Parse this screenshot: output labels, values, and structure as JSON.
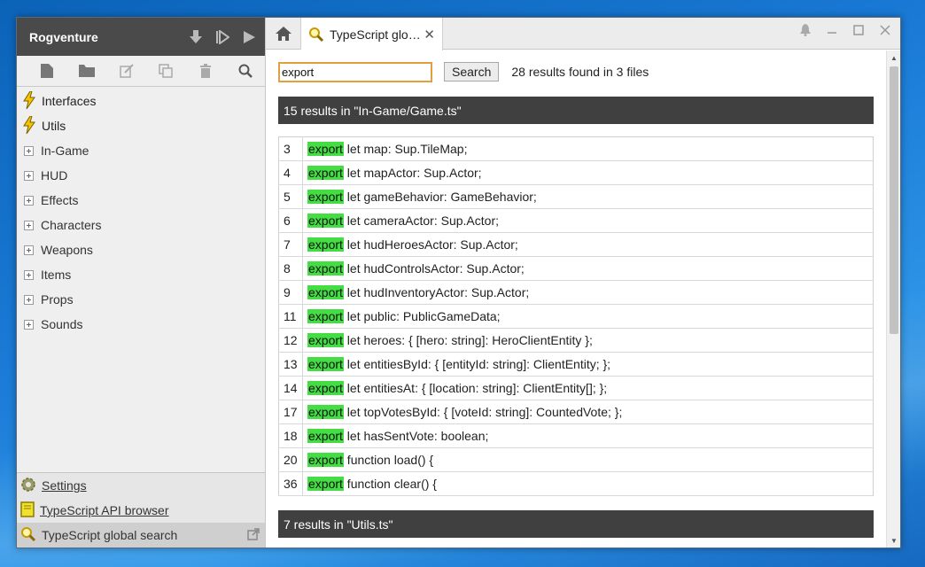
{
  "app": {
    "project_name": "Rogventure"
  },
  "sidebar": {
    "tree": [
      {
        "label": "Interfaces",
        "kind": "script",
        "icon": "lightning-icon"
      },
      {
        "label": "Utils",
        "kind": "script",
        "icon": "lightning-icon"
      },
      {
        "label": "In-Game",
        "kind": "folder"
      },
      {
        "label": "HUD",
        "kind": "folder"
      },
      {
        "label": "Effects",
        "kind": "folder"
      },
      {
        "label": "Characters",
        "kind": "folder"
      },
      {
        "label": "Weapons",
        "kind": "folder"
      },
      {
        "label": "Items",
        "kind": "folder"
      },
      {
        "label": "Props",
        "kind": "folder"
      },
      {
        "label": "Sounds",
        "kind": "folder"
      }
    ],
    "tools": [
      {
        "label": "Settings",
        "icon": "gear-icon"
      },
      {
        "label": "TypeScript API browser",
        "icon": "book-icon"
      },
      {
        "label": "TypeScript global search",
        "icon": "magnifier-icon",
        "active": true
      }
    ]
  },
  "tabs": [
    {
      "label": "TypeScript glo…",
      "close": "✕"
    }
  ],
  "search": {
    "value": "export",
    "button_label": "Search",
    "summary": "28 results found in 3 files"
  },
  "file_groups": [
    {
      "header": "15 results in \"In-Game/Game.ts\"",
      "rows": [
        {
          "line": "3",
          "match": "export",
          "rest": " let map: Sup.TileMap;"
        },
        {
          "line": "4",
          "match": "export",
          "rest": " let mapActor: Sup.Actor;"
        },
        {
          "line": "5",
          "match": "export",
          "rest": " let gameBehavior: GameBehavior;"
        },
        {
          "line": "6",
          "match": "export",
          "rest": " let cameraActor: Sup.Actor;"
        },
        {
          "line": "7",
          "match": "export",
          "rest": " let hudHeroesActor: Sup.Actor;"
        },
        {
          "line": "8",
          "match": "export",
          "rest": " let hudControlsActor: Sup.Actor;"
        },
        {
          "line": "9",
          "match": "export",
          "rest": " let hudInventoryActor: Sup.Actor;"
        },
        {
          "line": "11",
          "match": "export",
          "rest": " let public: PublicGameData;"
        },
        {
          "line": "12",
          "match": "export",
          "rest": " let heroes: { [hero: string]: HeroClientEntity };"
        },
        {
          "line": "13",
          "match": "export",
          "rest": " let entitiesById: { [entityId: string]: ClientEntity; };"
        },
        {
          "line": "14",
          "match": "export",
          "rest": " let entitiesAt: { [location: string]: ClientEntity[]; };"
        },
        {
          "line": "17",
          "match": "export",
          "rest": " let topVotesById: { [voteId: string]: CountedVote; };"
        },
        {
          "line": "18",
          "match": "export",
          "rest": " let hasSentVote: boolean;"
        },
        {
          "line": "20",
          "match": "export",
          "rest": " function load() {"
        },
        {
          "line": "36",
          "match": "export",
          "rest": " function clear() {"
        }
      ]
    },
    {
      "header": "7 results in \"Utils.ts\"",
      "rows": []
    }
  ],
  "colors": {
    "highlight": "#44dd44",
    "header_bg": "#404040",
    "sidebar_header_bg": "#4a4a4a",
    "search_focus_border": "#e0a040"
  }
}
